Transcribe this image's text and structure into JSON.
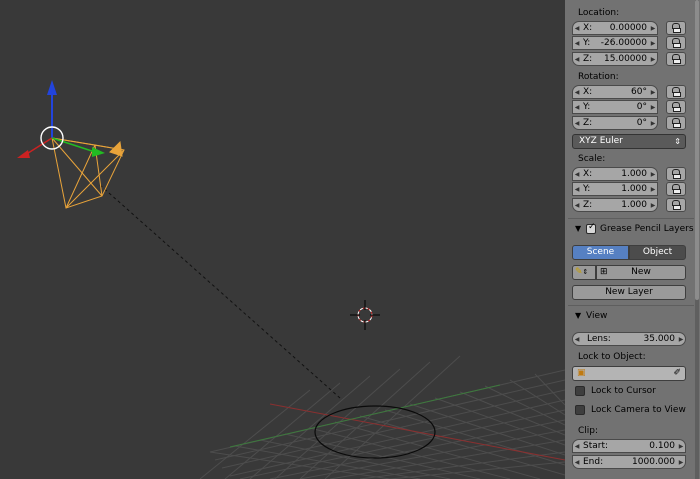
{
  "location": {
    "label": "Location:",
    "x": {
      "axis": "X:",
      "value": "0.00000"
    },
    "y": {
      "axis": "Y:",
      "value": "-26.00000"
    },
    "z": {
      "axis": "Z:",
      "value": "15.00000"
    }
  },
  "rotation": {
    "label": "Rotation:",
    "x": {
      "axis": "X:",
      "value": "60°"
    },
    "y": {
      "axis": "Y:",
      "value": "0°"
    },
    "z": {
      "axis": "Z:",
      "value": "0°"
    },
    "mode": "XYZ Euler"
  },
  "scale": {
    "label": "Scale:",
    "x": {
      "axis": "X:",
      "value": "1.000"
    },
    "y": {
      "axis": "Y:",
      "value": "1.000"
    },
    "z": {
      "axis": "Z:",
      "value": "1.000"
    }
  },
  "grease_pencil": {
    "title": "Grease Pencil Layers",
    "tab_scene": "Scene",
    "tab_object": "Object",
    "new_label": "New",
    "new_layer_label": "New Layer"
  },
  "view": {
    "title": "View",
    "lens_label": "Lens:",
    "lens_value": "35.000",
    "lock_to_object": "Lock to Object:",
    "lock_to_cursor": "Lock to Cursor",
    "lock_camera_to_view": "Lock Camera to View",
    "clip_label": "Clip:",
    "clip_start_label": "Start:",
    "clip_start_value": "0.100",
    "clip_end_label": "End:",
    "clip_end_value": "1000.000"
  },
  "colors": {
    "viewport_bg": "#393939",
    "panel_bg": "#727272",
    "active_tab": "#5680c2",
    "camera_wire": "#e8a33a",
    "axis_x": "#cc2222",
    "axis_y": "#22bb22",
    "axis_z": "#2244dd"
  }
}
